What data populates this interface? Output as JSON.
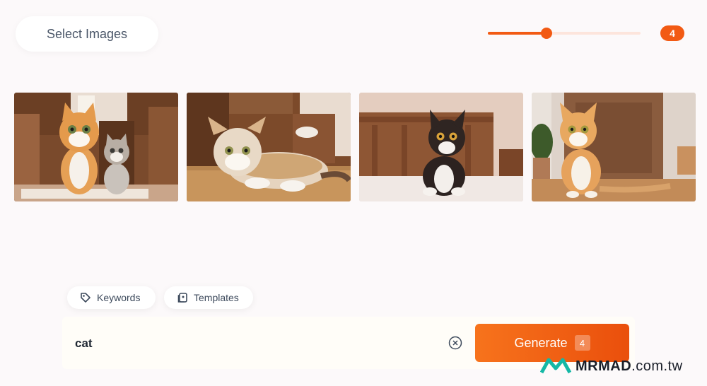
{
  "toolbar": {
    "select_images_label": "Select Images",
    "image_count": 4,
    "image_count_label": "4",
    "image_count_max": 8
  },
  "gallery": {
    "images": [
      {
        "alt": "two cartoon tabby cats sitting in a wooden room"
      },
      {
        "alt": "tabby cat lying on the floor near a chair"
      },
      {
        "alt": "black and white kitten on a bed"
      },
      {
        "alt": "orange tabby cat sitting by a door"
      }
    ]
  },
  "chips": {
    "keywords_label": "Keywords",
    "templates_label": "Templates"
  },
  "prompt": {
    "value": "cat",
    "generate_label": "Generate",
    "generate_count": "4"
  },
  "watermark": {
    "brand": "MRMAD",
    "domain": ".com.tw"
  },
  "colors": {
    "accent": "#f25a13",
    "background": "#fcf9fa",
    "text": "#3d4a5c"
  }
}
